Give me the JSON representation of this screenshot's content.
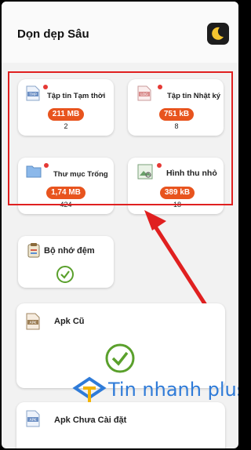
{
  "header": {
    "title": "Dọn dẹp Sâu",
    "theme_icon": "moon-icon"
  },
  "cards": [
    {
      "title": "Tập tin Tạm thời",
      "size": "211 MB",
      "count": "2",
      "icon_label": "TMP"
    },
    {
      "title": "Tập tin Nhật ký",
      "size": "751 kB",
      "count": "8",
      "icon_label": "LOG"
    },
    {
      "title": "Thư mục Trống",
      "size": "1,74 MB",
      "count": "424",
      "icon": "folder-icon"
    },
    {
      "title": "Hình thu nhỏ",
      "size": "389 kB",
      "count": "18",
      "icon": "image-icon"
    }
  ],
  "cache": {
    "title": "Bộ nhớ đệm",
    "status_icon": "check-icon"
  },
  "apk_old": {
    "title": "Apk Cũ",
    "icon_label": "APK",
    "status_icon": "check-icon"
  },
  "apk_uninstalled": {
    "title": "Apk Chưa Cài đặt",
    "icon_label": "APK"
  },
  "watermark": {
    "text": "Tin nhanh plus"
  },
  "colors": {
    "pill": "#e8541e",
    "check": "#5aa02c",
    "highlight": "#e02020",
    "arrow": "#e02020",
    "watermark": "#2f7bd8"
  }
}
